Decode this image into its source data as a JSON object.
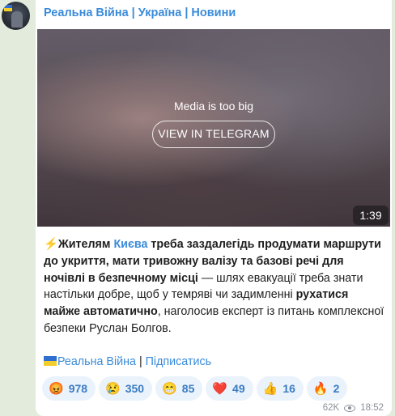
{
  "channel": {
    "title": "Реальна Війна | Україна | Новини"
  },
  "media": {
    "notice": "Media is too big",
    "button_label": "VIEW IN TELEGRAM",
    "duration": "1:39"
  },
  "message": {
    "bolt": "⚡",
    "p1_bold": "Жителям ",
    "p1_link": "Києва",
    "p1_bold2": " треба заздалегідь продумати маршрути до укриття, мати тривожну валізу та базові речі для ночівлі в безпечному місці",
    "p2": " — шлях евакуації треба знати настільки добре, щоб у темряві чи задимленні ",
    "p2_bold": "рухатися майже автоматично",
    "p3": ", наголосив експерт із питань комплексної безпеки Руслан Болгов."
  },
  "signature": {
    "channel_link": "Реальна Війна",
    "separator": " | ",
    "subscribe_link": "Підписатись"
  },
  "reactions": [
    {
      "emoji": "😡",
      "count": "978"
    },
    {
      "emoji": "😢",
      "count": "350"
    },
    {
      "emoji": "😁",
      "count": "85"
    },
    {
      "emoji": "❤️",
      "count": "49"
    },
    {
      "emoji": "👍",
      "count": "16"
    },
    {
      "emoji": "🔥",
      "count": "2"
    }
  ],
  "meta": {
    "views": "62K",
    "time": "18:52"
  }
}
